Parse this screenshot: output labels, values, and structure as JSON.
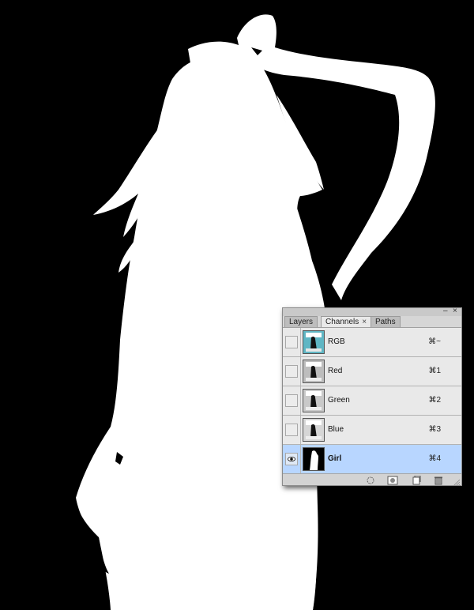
{
  "panel": {
    "tabs": [
      {
        "label": "Layers",
        "active": false
      },
      {
        "label": "Channels",
        "active": true,
        "close": "×"
      },
      {
        "label": "Paths",
        "active": false
      }
    ],
    "controls": {
      "minimize": "–",
      "close": "×",
      "menu": "▾≡"
    },
    "channels": [
      {
        "name": "RGB",
        "shortcut": "⌘~",
        "visible": false,
        "selected": false,
        "thumb": "rgb"
      },
      {
        "name": "Red",
        "shortcut": "⌘1",
        "visible": false,
        "selected": false,
        "thumb": "gray"
      },
      {
        "name": "Green",
        "shortcut": "⌘2",
        "visible": false,
        "selected": false,
        "thumb": "gray"
      },
      {
        "name": "Blue",
        "shortcut": "⌘3",
        "visible": false,
        "selected": false,
        "thumb": "gray"
      },
      {
        "name": "Girl",
        "shortcut": "⌘4",
        "visible": true,
        "selected": true,
        "thumb": "mask"
      }
    ],
    "footer_buttons": [
      "load-selection-icon",
      "save-selection-icon",
      "new-channel-icon",
      "delete-channel-icon"
    ]
  },
  "colors": {
    "canvas_bg": "#000000",
    "silhouette": "#ffffff",
    "selected_row": "#b8d6ff",
    "panel_bg": "#e9e9e9"
  }
}
